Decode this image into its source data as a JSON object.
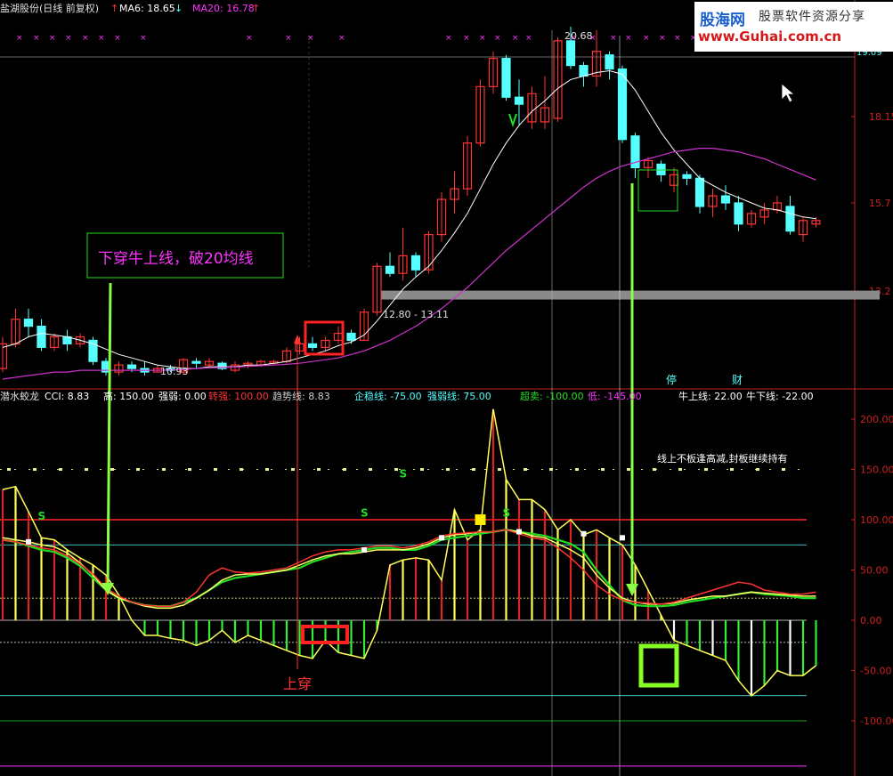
{
  "main_header": {
    "stock": "盐湖股份(日线 前复权)",
    "ma6": "MA6: 18.65",
    "ma20": "MA20: 16.78"
  },
  "sub_header": {
    "name": "潜水蛟龙",
    "cci": "CCI: 8.83",
    "gao": "高: 150.00",
    "qiangruo": "强弱: 0.00",
    "zhuanqiang": "转强: 100.00",
    "qushixian": "趋势线: 8.83",
    "qiwenxian": "企稳线: -75.00",
    "qiangruoxian": "强弱线: 75.00",
    "chaomai": "超卖: -100.00",
    "di": "低: -145.00",
    "niushang": "牛上线: 22.00",
    "niuxia": "牛下线: -22.00"
  },
  "watermark": {
    "brand": "股海网",
    "slogan": "股票软件资源分享",
    "url": "www.Guhai.com.cn"
  },
  "colors": {
    "up": "#ff3333",
    "down": "#55ffff",
    "ma6": "#ffffff",
    "ma20": "#cc33cc",
    "cci": "#ffff33",
    "trend": "#22dd22",
    "magenta": "#ff33ff"
  },
  "chart_data": [
    {
      "type": "candlestick",
      "price_axis_labels": [
        "18.15",
        "15.7",
        "13.2"
      ],
      "price_ticks": [
        18.15,
        15.7,
        13.2
      ],
      "ylim": [
        10.0,
        22.0
      ],
      "annotations": {
        "high": "20.68",
        "low": "10.93",
        "band": "12.80 - 13.11",
        "callout": "下穿牛上线，破20均线",
        "event1": "停",
        "event2": "财",
        "top_right": "19.09"
      },
      "candles": [
        {
          "o": 11.0,
          "c": 11.7,
          "h": 11.9,
          "l": 10.9
        },
        {
          "o": 11.7,
          "c": 12.4,
          "h": 12.7,
          "l": 11.6
        },
        {
          "o": 12.4,
          "c": 12.2,
          "h": 12.7,
          "l": 11.9
        },
        {
          "o": 12.2,
          "c": 11.6,
          "h": 12.4,
          "l": 11.5
        },
        {
          "o": 11.6,
          "c": 11.9,
          "h": 12.0,
          "l": 11.5
        },
        {
          "o": 11.9,
          "c": 11.7,
          "h": 12.1,
          "l": 11.5
        },
        {
          "o": 11.7,
          "c": 11.9,
          "h": 12.0,
          "l": 11.6
        },
        {
          "o": 11.8,
          "c": 11.2,
          "h": 11.9,
          "l": 11.1
        },
        {
          "o": 11.2,
          "c": 10.9,
          "h": 11.3,
          "l": 10.8
        },
        {
          "o": 10.9,
          "c": 11.1,
          "h": 11.2,
          "l": 10.8
        },
        {
          "o": 11.1,
          "c": 11.0,
          "h": 11.2,
          "l": 10.9
        },
        {
          "o": 11.0,
          "c": 10.9,
          "h": 11.2,
          "l": 10.8
        },
        {
          "o": 10.9,
          "c": 11.0,
          "h": 11.1,
          "l": 10.9
        },
        {
          "o": 11.0,
          "c": 10.95,
          "h": 11.1,
          "l": 10.9
        },
        {
          "o": 10.9,
          "c": 11.25,
          "h": 11.3,
          "l": 10.85
        },
        {
          "o": 11.2,
          "c": 11.15,
          "h": 11.3,
          "l": 11.0
        },
        {
          "o": 11.1,
          "c": 11.2,
          "h": 11.3,
          "l": 11.05
        },
        {
          "o": 11.15,
          "c": 11.0,
          "h": 11.2,
          "l": 10.95
        },
        {
          "o": 10.95,
          "c": 11.1,
          "h": 11.2,
          "l": 10.9
        },
        {
          "o": 11.1,
          "c": 11.15,
          "h": 11.2,
          "l": 11.0
        },
        {
          "o": 11.1,
          "c": 11.2,
          "h": 11.25,
          "l": 11.05
        },
        {
          "o": 11.15,
          "c": 11.2,
          "h": 11.25,
          "l": 11.1
        },
        {
          "o": 11.2,
          "c": 11.5,
          "h": 11.6,
          "l": 11.15
        },
        {
          "o": 11.5,
          "c": 11.7,
          "h": 11.9,
          "l": 11.4
        },
        {
          "o": 11.7,
          "c": 11.6,
          "h": 11.9,
          "l": 11.5
        },
        {
          "o": 11.6,
          "c": 11.8,
          "h": 11.9,
          "l": 11.5
        },
        {
          "o": 11.8,
          "c": 12.0,
          "h": 12.2,
          "l": 11.7
        },
        {
          "o": 12.0,
          "c": 11.8,
          "h": 12.1,
          "l": 11.7
        },
        {
          "o": 11.8,
          "c": 12.6,
          "h": 12.7,
          "l": 11.8
        },
        {
          "o": 12.6,
          "c": 13.9,
          "h": 14.0,
          "l": 12.5
        },
        {
          "o": 13.9,
          "c": 13.7,
          "h": 14.3,
          "l": 13.6
        },
        {
          "o": 13.7,
          "c": 14.2,
          "h": 15.0,
          "l": 13.5
        },
        {
          "o": 14.2,
          "c": 13.8,
          "h": 14.3,
          "l": 13.6
        },
        {
          "o": 13.8,
          "c": 14.8,
          "h": 14.9,
          "l": 13.7
        },
        {
          "o": 14.8,
          "c": 15.8,
          "h": 16.0,
          "l": 14.6
        },
        {
          "o": 15.8,
          "c": 16.1,
          "h": 16.6,
          "l": 15.4
        },
        {
          "o": 16.1,
          "c": 17.4,
          "h": 17.6,
          "l": 15.9
        },
        {
          "o": 17.4,
          "c": 19.0,
          "h": 19.2,
          "l": 17.3
        },
        {
          "o": 19.0,
          "c": 19.8,
          "h": 20.0,
          "l": 18.8
        },
        {
          "o": 19.8,
          "c": 18.7,
          "h": 19.9,
          "l": 18.6
        },
        {
          "o": 18.7,
          "c": 18.5,
          "h": 19.2,
          "l": 17.9
        },
        {
          "o": 18.0,
          "c": 18.8,
          "h": 19.0,
          "l": 17.8
        },
        {
          "o": 18.0,
          "c": 18.4,
          "h": 19.3,
          "l": 17.8
        },
        {
          "o": 18.1,
          "c": 20.3,
          "h": 20.4,
          "l": 18.0
        },
        {
          "o": 20.3,
          "c": 19.6,
          "h": 20.7,
          "l": 19.5
        },
        {
          "o": 19.6,
          "c": 19.3,
          "h": 19.7,
          "l": 19.0
        },
        {
          "o": 19.3,
          "c": 20.0,
          "h": 20.6,
          "l": 19.0
        },
        {
          "o": 19.9,
          "c": 19.5,
          "h": 20.0,
          "l": 19.2
        },
        {
          "o": 19.5,
          "c": 17.5,
          "h": 19.6,
          "l": 17.4
        },
        {
          "o": 17.6,
          "c": 16.7,
          "h": 17.7,
          "l": 16.4
        },
        {
          "o": 16.7,
          "c": 16.9,
          "h": 17.0,
          "l": 16.4
        },
        {
          "o": 16.8,
          "c": 16.5,
          "h": 16.9,
          "l": 16.3
        },
        {
          "o": 16.2,
          "c": 16.5,
          "h": 16.7,
          "l": 16.0
        },
        {
          "o": 16.5,
          "c": 16.4,
          "h": 16.6,
          "l": 16.2
        },
        {
          "o": 16.4,
          "c": 15.6,
          "h": 16.5,
          "l": 15.4
        },
        {
          "o": 15.6,
          "c": 15.9,
          "h": 16.1,
          "l": 15.3
        },
        {
          "o": 15.9,
          "c": 15.7,
          "h": 16.2,
          "l": 15.5
        },
        {
          "o": 15.7,
          "c": 15.1,
          "h": 15.9,
          "l": 14.9
        },
        {
          "o": 15.1,
          "c": 15.4,
          "h": 15.5,
          "l": 15.0
        },
        {
          "o": 15.3,
          "c": 15.5,
          "h": 15.7,
          "l": 15.1
        },
        {
          "o": 15.5,
          "c": 15.7,
          "h": 15.9,
          "l": 15.4
        },
        {
          "o": 15.6,
          "c": 14.9,
          "h": 15.9,
          "l": 14.8
        },
        {
          "o": 14.8,
          "c": 15.2,
          "h": 15.3,
          "l": 14.6
        },
        {
          "o": 15.1,
          "c": 15.2,
          "h": 15.3,
          "l": 15.0
        }
      ],
      "ma6": [
        11.6,
        11.7,
        11.9,
        12.0,
        11.95,
        11.9,
        11.8,
        11.7,
        11.55,
        11.4,
        11.3,
        11.2,
        11.1,
        11.05,
        11.0,
        11.0,
        11.05,
        11.05,
        11.05,
        11.1,
        11.1,
        11.15,
        11.2,
        11.3,
        11.4,
        11.5,
        11.65,
        11.75,
        11.95,
        12.35,
        12.8,
        13.25,
        13.6,
        13.9,
        14.35,
        14.85,
        15.4,
        16.1,
        16.8,
        17.4,
        17.9,
        18.3,
        18.6,
        18.95,
        19.2,
        19.3,
        19.4,
        19.45,
        19.35,
        18.9,
        18.3,
        17.7,
        17.2,
        16.8,
        16.4,
        16.2,
        16.0,
        15.85,
        15.7,
        15.55,
        15.5,
        15.4,
        15.3,
        15.25
      ],
      "ma20": [
        10.7,
        10.75,
        10.8,
        10.85,
        10.9,
        10.9,
        10.95,
        10.95,
        10.95,
        10.95,
        10.95,
        10.95,
        10.95,
        10.96,
        10.97,
        11.0,
        11.02,
        11.03,
        11.04,
        11.06,
        11.08,
        11.1,
        11.12,
        11.15,
        11.2,
        11.25,
        11.3,
        11.4,
        11.5,
        11.65,
        11.8,
        12.0,
        12.2,
        12.45,
        12.7,
        13.0,
        13.3,
        13.65,
        14.0,
        14.35,
        14.65,
        14.95,
        15.25,
        15.55,
        15.85,
        16.15,
        16.4,
        16.6,
        16.75,
        16.85,
        16.95,
        17.05,
        17.15,
        17.2,
        17.25,
        17.25,
        17.2,
        17.15,
        17.05,
        16.95,
        16.8,
        16.65,
        16.5,
        16.35
      ]
    },
    {
      "type": "line",
      "title": "潜水蛟龙",
      "y_axis_labels": [
        "200.00",
        "150.00",
        "100.00",
        "50.00",
        "0.00",
        "-50.00",
        "-100.00"
      ],
      "y_ticks": [
        200,
        150,
        100,
        50,
        0,
        -50,
        -100
      ],
      "ylim": [
        -150,
        215
      ],
      "levels": {
        "high": 150,
        "zhuanqiang": 100,
        "qiangruoxian": 75,
        "niushang": 22,
        "zero": 0,
        "niuxia": -22,
        "qiwenxian": -75,
        "chaomai": -100,
        "di": -145
      },
      "annotations": {
        "crossup": "上穿",
        "note": "线上不板逢高减,封板继续持有",
        "s": "S"
      },
      "cci": [
        130,
        133,
        108,
        82,
        80,
        70,
        62,
        55,
        45,
        25,
        0,
        -15,
        -15,
        -18,
        -20,
        -25,
        -20,
        -10,
        -22,
        -15,
        -20,
        -25,
        -30,
        -35,
        -38,
        -20,
        -32,
        -35,
        -38,
        -10,
        55,
        60,
        62,
        60,
        40,
        110,
        80,
        90,
        210,
        140,
        120,
        120,
        110,
        90,
        100,
        85,
        90,
        82,
        75,
        55,
        30,
        5,
        -20,
        -25,
        -30,
        -35,
        -40,
        -60,
        -75,
        -65,
        -50,
        -55,
        -55,
        -45
      ],
      "trend": [
        80,
        78,
        74,
        70,
        68,
        62,
        54,
        42,
        30,
        22,
        18,
        15,
        14,
        14,
        18,
        22,
        30,
        38,
        42,
        44,
        46,
        48,
        50,
        52,
        58,
        62,
        66,
        68,
        70,
        72,
        72,
        70,
        70,
        74,
        80,
        82,
        84,
        86,
        88,
        90,
        88,
        86,
        84,
        80,
        76,
        68,
        50,
        35,
        20,
        15,
        14,
        14,
        15,
        18,
        20,
        22,
        24,
        26,
        28,
        26,
        25,
        24,
        22,
        22
      ],
      "yellow": [
        82,
        80,
        78,
        75,
        73,
        67,
        57,
        45,
        30,
        22,
        18,
        14,
        12,
        12,
        15,
        22,
        30,
        40,
        45,
        46,
        46,
        48,
        50,
        55,
        60,
        64,
        66,
        66,
        68,
        70,
        70,
        70,
        72,
        76,
        82,
        85,
        86,
        88,
        88,
        90,
        88,
        84,
        82,
        76,
        70,
        62,
        45,
        32,
        22,
        18,
        16,
        16,
        17,
        20,
        22,
        24,
        24,
        26,
        28,
        27,
        26,
        25,
        24,
        24
      ],
      "red": [
        80,
        78,
        75,
        72,
        70,
        64,
        56,
        46,
        32,
        24,
        18,
        15,
        14,
        14,
        18,
        28,
        45,
        52,
        48,
        47,
        48,
        50,
        52,
        58,
        64,
        68,
        70,
        70,
        72,
        74,
        74,
        72,
        74,
        78,
        84,
        86,
        87,
        88,
        88,
        90,
        86,
        82,
        80,
        72,
        62,
        50,
        35,
        26,
        20,
        18,
        17,
        16,
        18,
        22,
        26,
        30,
        34,
        38,
        36,
        30,
        28,
        26,
        26,
        28
      ]
    }
  ]
}
